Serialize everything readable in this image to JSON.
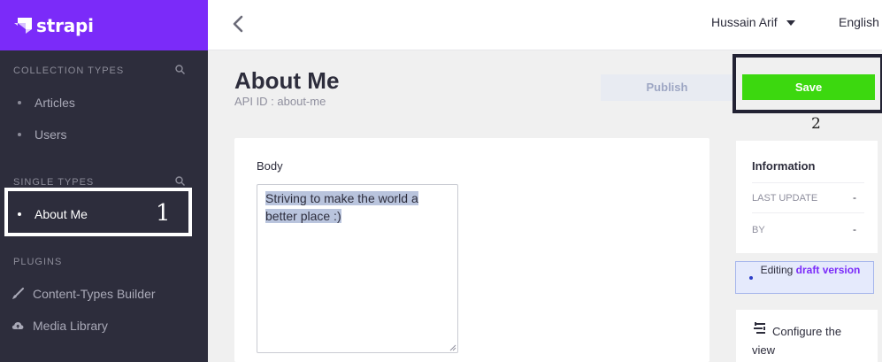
{
  "brand": {
    "name": "strapi",
    "color": "#7b2bf9"
  },
  "sidebar": {
    "collection_types": {
      "heading": "COLLECTION TYPES",
      "items": [
        {
          "label": "Articles"
        },
        {
          "label": "Users"
        }
      ]
    },
    "single_types": {
      "heading": "SINGLE TYPES",
      "items": [
        {
          "label": "About Me",
          "active": true
        }
      ]
    },
    "plugins": {
      "heading": "PLUGINS",
      "items": [
        {
          "label": "Content-Types Builder",
          "icon": "paintbrush-icon"
        },
        {
          "label": "Media Library",
          "icon": "cloud-upload-icon"
        }
      ]
    }
  },
  "header": {
    "user_name": "Hussain Arif",
    "language": "English"
  },
  "page": {
    "title": "About Me",
    "api_id": "API ID : about-me",
    "publish_label": "Publish",
    "save_label": "Save"
  },
  "form": {
    "field_label": "Body",
    "body_value": "Striving to make the world a better place :)"
  },
  "info_panel": {
    "title": "Information",
    "last_update_label": "LAST UPDATE",
    "last_update_value": "-",
    "by_label": "BY",
    "by_value": "-"
  },
  "draft": {
    "prefix": "Editing",
    "state": "draft",
    "suffix": "version"
  },
  "configure_label": "Configure the view",
  "annotations": {
    "first": "1",
    "second": "2"
  },
  "colors": {
    "save": "#3cd80f",
    "sidebar": "#2d2d3c",
    "selection": "#b9c4dd"
  }
}
